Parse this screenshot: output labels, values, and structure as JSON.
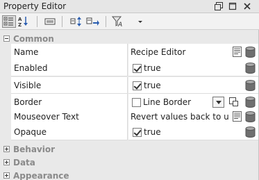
{
  "window": {
    "title": "Property Editor"
  },
  "toolbar": {
    "buttons": [
      "categorized-view",
      "alphabetical-view",
      "properties-button",
      "move-up-down-button",
      "move-right-button",
      "filter-button",
      "dropdown-button"
    ]
  },
  "categories": [
    {
      "label": "Common",
      "expanded": true,
      "properties": [
        {
          "name": "Name",
          "value": "Recipe Editor",
          "editor": "text"
        },
        {
          "name": "Enabled",
          "value": "true",
          "editor": "checkbox",
          "checked": true
        },
        {
          "name": "Visible",
          "value": "true",
          "editor": "checkbox",
          "checked": true
        },
        {
          "name": "Border",
          "value": "Line Border",
          "editor": "border"
        },
        {
          "name": "Mouseover Text",
          "value": "Revert values back to usir",
          "editor": "text"
        },
        {
          "name": "Opaque",
          "value": "true",
          "editor": "checkbox",
          "checked": true
        }
      ]
    },
    {
      "label": "Behavior",
      "expanded": false
    },
    {
      "label": "Data",
      "expanded": false
    },
    {
      "label": "Appearance",
      "expanded": false
    }
  ],
  "colors": {
    "title_bg": "#e6e6e6",
    "grid_bg": "#e9e9e9",
    "category_text": "#8a8a8a",
    "binding_icon": "#6f6f6f"
  }
}
